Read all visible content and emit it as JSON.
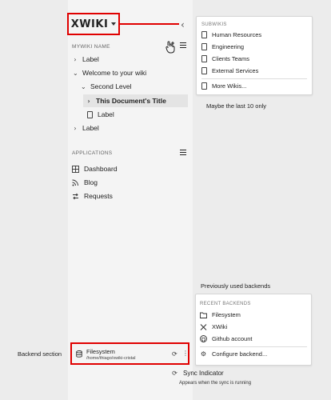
{
  "logo": {
    "text": "XWIKI"
  },
  "sidebar": {
    "wiki_section_title": "MYWIKI NAME",
    "tree": [
      {
        "label": "Label"
      },
      {
        "label": "Welcome to your wiki"
      },
      {
        "label": "Second Level"
      },
      {
        "label": "This Document's Title"
      },
      {
        "label": "Label"
      },
      {
        "label": "Label"
      }
    ],
    "apps_section_title": "APPLICATIONS",
    "apps": [
      {
        "label": "Dashboard",
        "icon": "grid-icon"
      },
      {
        "label": "Blog",
        "icon": "rss-icon"
      },
      {
        "label": "Requests",
        "icon": "requests-icon"
      }
    ],
    "backend": {
      "name": "Filesystem",
      "path": "/home/thiago/xwiki-cristal"
    }
  },
  "subwikis_card": {
    "title": "SUBWIKIS",
    "items": [
      "Human Resources",
      "Engineering",
      "Clients Teams",
      "External Services"
    ],
    "more_label": "More Wikis..."
  },
  "notes": {
    "subwikis": "Maybe the last 10 only",
    "backends_title": "Previously used backends",
    "backend_section": "Backend section",
    "sync_title": "Sync Indicator",
    "sync_desc": "Appears when the sync is running"
  },
  "backends_card": {
    "title": "RECENT BACKENDS",
    "items": [
      {
        "label": "Filesystem",
        "icon": "folder-icon"
      },
      {
        "label": "XWiki",
        "icon": "xwiki-icon"
      },
      {
        "label": "Github account",
        "icon": "github-icon"
      }
    ],
    "configure_label": "Configure backend..."
  },
  "colors": {
    "highlight": "#e00000",
    "sidebar_bg": "#f4f4f4",
    "page_bg": "#ececec"
  }
}
